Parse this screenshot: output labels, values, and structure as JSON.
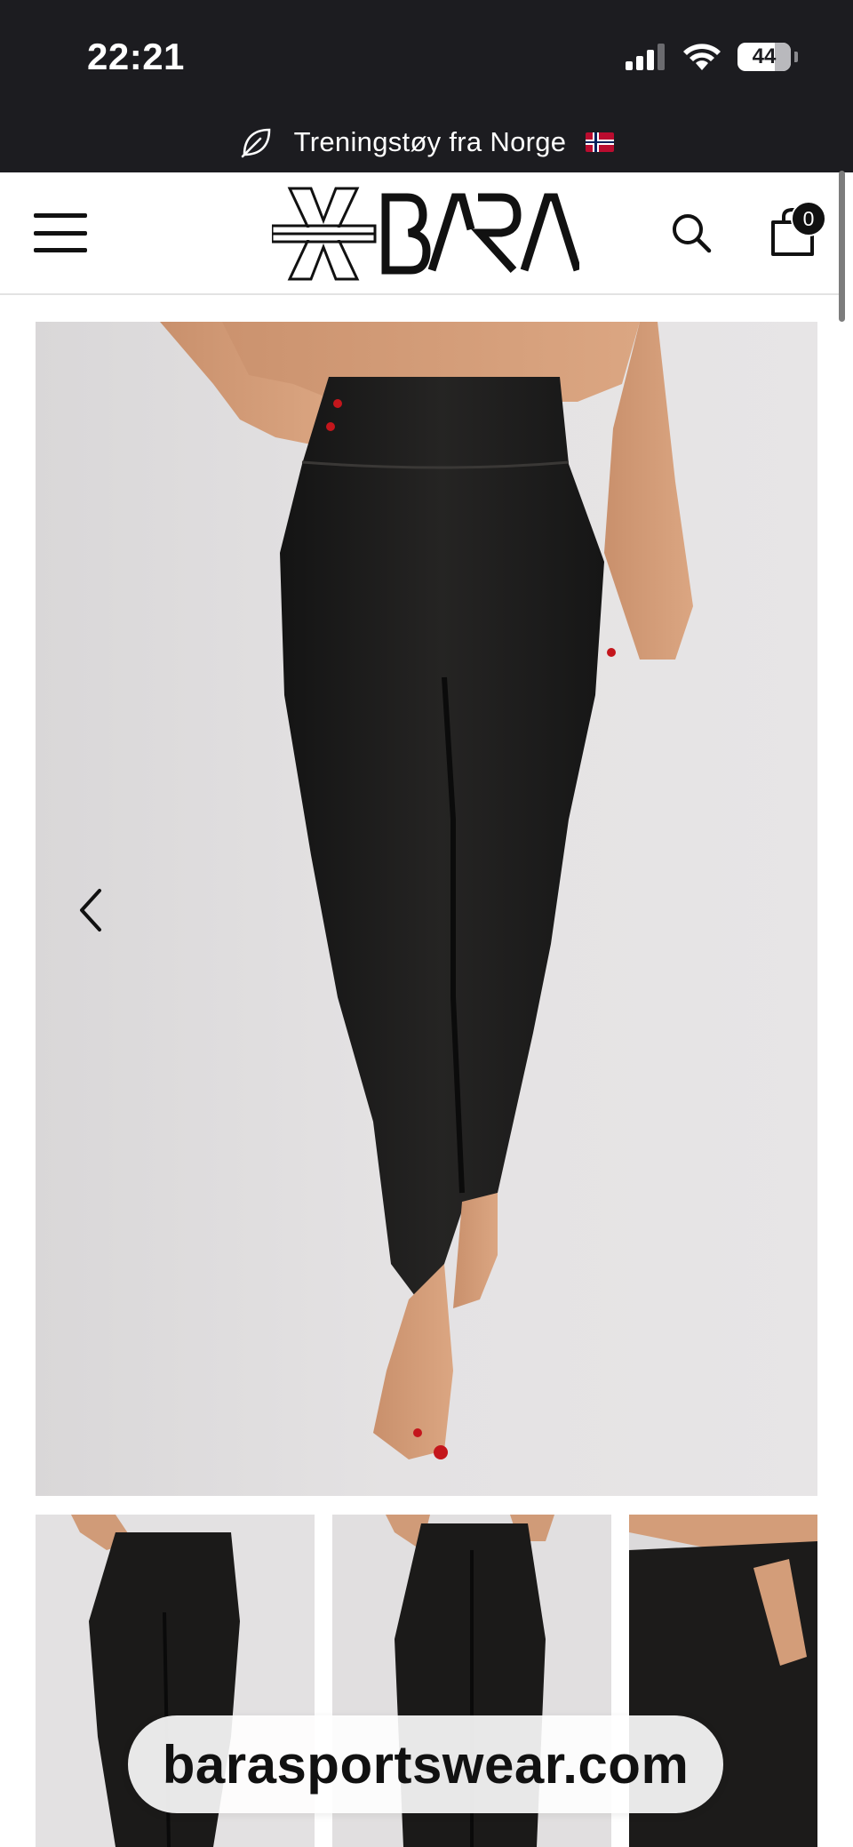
{
  "status_bar": {
    "time": "22:21",
    "battery_level": "44",
    "icons": [
      "cellular-signal-icon",
      "wifi-icon",
      "battery-icon"
    ]
  },
  "announcement": {
    "icon": "leaf-icon",
    "text": "Treningstøy fra Norge",
    "flag": "norway-flag-icon"
  },
  "header": {
    "logo_text": "BARA",
    "menu_icon": "hamburger-menu-icon",
    "search_icon": "search-icon",
    "cart_icon": "shopping-bag-icon",
    "cart_count": "0"
  },
  "product_gallery": {
    "main_image": "black-high-waist-leggings-front",
    "prev_icon": "chevron-left-icon",
    "thumbnails": [
      "black-leggings-front-view",
      "black-leggings-back-view",
      "black-leggings-waist-detail"
    ]
  },
  "overlay": {
    "domain": "barasportswear.com"
  },
  "colors": {
    "bar_background": "#1c1c20",
    "text_dark": "#111111",
    "background": "#ffffff",
    "photo_background": "#e4e2e3"
  }
}
